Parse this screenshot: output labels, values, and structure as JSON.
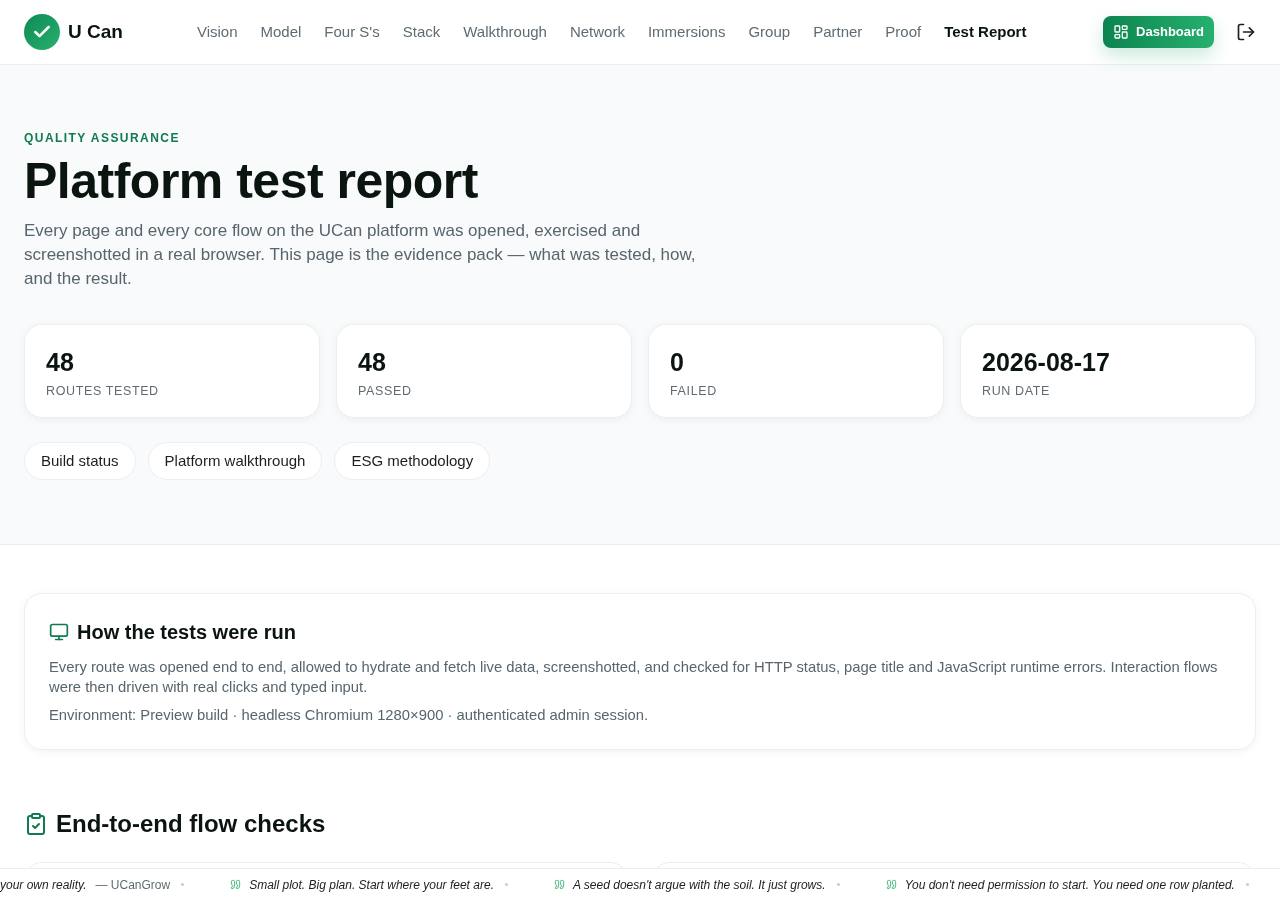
{
  "header": {
    "brand": "U Can",
    "nav": [
      {
        "label": "Vision",
        "selected": false
      },
      {
        "label": "Model",
        "selected": false
      },
      {
        "label": "Four S's",
        "selected": false
      },
      {
        "label": "Stack",
        "selected": false
      },
      {
        "label": "Walkthrough",
        "selected": false
      },
      {
        "label": "Network",
        "selected": false
      },
      {
        "label": "Immersions",
        "selected": false
      },
      {
        "label": "Group",
        "selected": false
      },
      {
        "label": "Partner",
        "selected": false
      },
      {
        "label": "Proof",
        "selected": false
      },
      {
        "label": "Test Report",
        "selected": true
      }
    ],
    "dashboard_button": "Dashboard"
  },
  "hero": {
    "eyebrow": "QUALITY ASSURANCE",
    "title": "Platform test report",
    "intro": "Every page and every core flow on the UCan platform was opened, exercised and screenshotted in a real browser. This page is the evidence pack — what was tested, how, and the result.",
    "stats": [
      {
        "value": "48",
        "label": "ROUTES TESTED"
      },
      {
        "value": "48",
        "label": "PASSED"
      },
      {
        "value": "0",
        "label": "FAILED"
      },
      {
        "value": "2026-08-17",
        "label": "RUN DATE"
      }
    ],
    "links": [
      "Build status",
      "Platform walkthrough",
      "ESG methodology"
    ]
  },
  "method_card": {
    "title": "How the tests were run",
    "body": "Every route was opened end to end, allowed to hydrate and fetch live data, screenshotted, and checked for HTTP status, page title and JavaScript runtime errors. Interaction flows were then driven with real clicks and typed input.",
    "environment": "Environment: Preview build · headless Chromium 1280×900 · authenticated admin session."
  },
  "flow_checks": {
    "title": "End-to-end flow checks"
  },
  "ticker": [
    {
      "kind": "tail",
      "quote": "your own reality.",
      "attribution": "— UCanGrow"
    },
    {
      "kind": "quote",
      "quote": "Small plot. Big plan. Start where your feet are."
    },
    {
      "kind": "quote",
      "quote": "A seed doesn't argue with the soil. It just grows."
    },
    {
      "kind": "quote",
      "quote": "You don't need permission to start. You need one row planted."
    }
  ]
}
